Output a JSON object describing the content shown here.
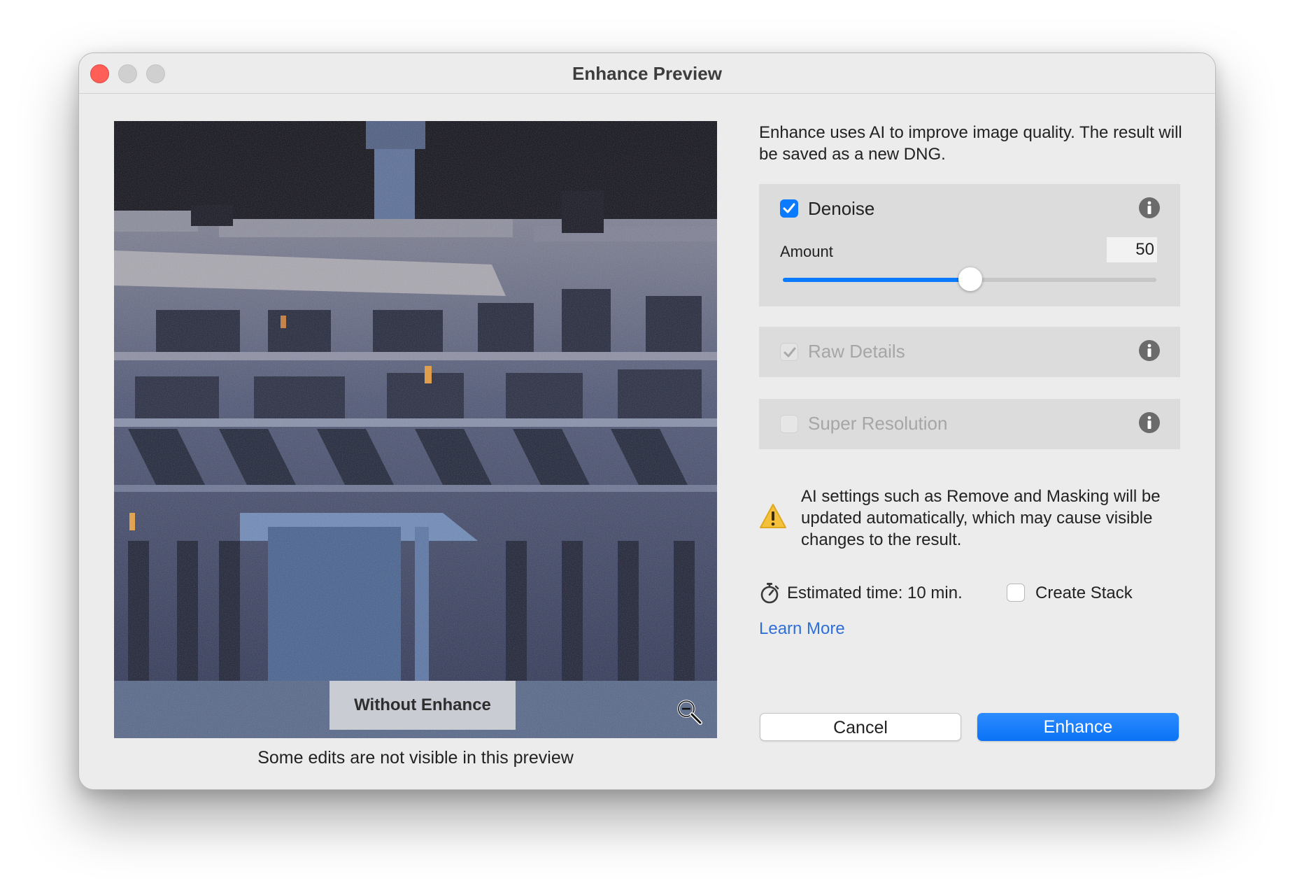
{
  "window": {
    "title": "Enhance Preview"
  },
  "preview": {
    "toggle_label": "Without Enhance",
    "note": "Some edits are not visible in this preview"
  },
  "panel": {
    "description": "Enhance uses AI to improve image quality. The result will be saved as a new DNG.",
    "denoise": {
      "label": "Denoise",
      "checked": true,
      "amount_label": "Amount",
      "amount_value": "50",
      "amount_fraction": 0.5
    },
    "raw_details": {
      "label": "Raw Details",
      "checked": true,
      "enabled": false
    },
    "super_resolution": {
      "label": "Super Resolution",
      "checked": false,
      "enabled": false
    },
    "warning": "AI settings such as Remove and Masking will be updated automatically, which may cause visible changes to the result.",
    "estimated_time": "Estimated time: 10 min.",
    "create_stack": {
      "label": "Create Stack",
      "checked": false
    },
    "learn_more": "Learn More"
  },
  "buttons": {
    "cancel": "Cancel",
    "enhance": "Enhance"
  },
  "colors": {
    "accent": "#0a7bff",
    "link": "#2f6fd8",
    "close": "#ff5f57",
    "warning": "#f5c13b"
  }
}
